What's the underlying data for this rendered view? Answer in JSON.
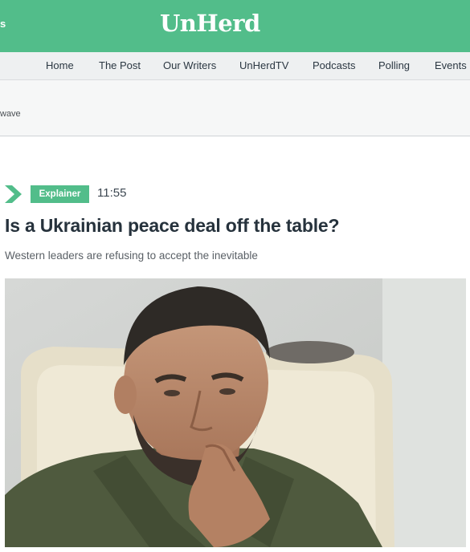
{
  "header": {
    "left_fragment": "s",
    "logo": "UnHerd",
    "brand_color": "#52bd8a"
  },
  "nav": {
    "items": [
      {
        "label": "Home"
      },
      {
        "label": "The Post"
      },
      {
        "label": "Our Writers"
      },
      {
        "label": "UnHerdTV"
      },
      {
        "label": "Podcasts"
      },
      {
        "label": "Polling"
      },
      {
        "label": "Events"
      }
    ]
  },
  "ticker": {
    "text": "wave"
  },
  "article": {
    "section_icon": "chevron-right-icon",
    "category": "Explainer",
    "time": "11:55",
    "headline": "Is a Ukrainian peace deal off the table?",
    "standfirst": "Western leaders are refusing to accept the inevitable"
  }
}
